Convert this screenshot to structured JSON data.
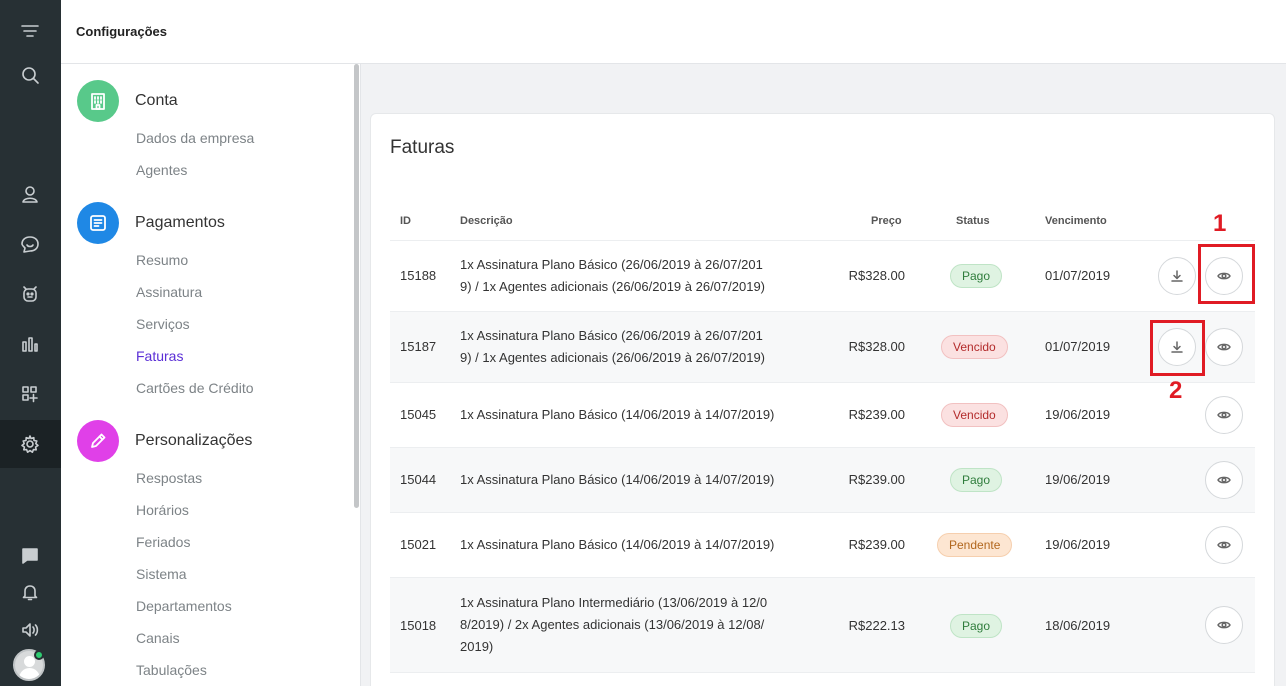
{
  "topbar": {
    "title": "Configurações"
  },
  "rail": {
    "icons": [
      "logo-icon",
      "search-icon",
      "user-icon",
      "chat-smile-icon",
      "bot-icon",
      "chart-icon",
      "apps-icon",
      "gear-icon",
      "message-icon",
      "bell-icon",
      "volume-icon"
    ]
  },
  "menu": {
    "sections": [
      {
        "title": "Conta",
        "icon": "building-icon",
        "color": "#58c98a",
        "items": [
          "Dados da empresa",
          "Agentes"
        ]
      },
      {
        "title": "Pagamentos",
        "icon": "receipt-icon",
        "color": "#1f88e5",
        "items": [
          "Resumo",
          "Assinatura",
          "Serviços",
          "Faturas",
          "Cartões de Crédito"
        ]
      },
      {
        "title": "Personalizações",
        "icon": "pencil-icon",
        "color": "#e040e8",
        "items": [
          "Respostas",
          "Horários",
          "Feriados",
          "Sistema",
          "Departamentos",
          "Canais",
          "Tabulações"
        ]
      }
    ],
    "active_item": "Faturas"
  },
  "card": {
    "title": "Faturas",
    "columns": {
      "id": "ID",
      "descricao": "Descrição",
      "preco": "Preço",
      "status": "Status",
      "vencimento": "Vencimento"
    },
    "rows": [
      {
        "id": "15188",
        "desc": [
          "1x Assinatura Plano Básico (26/06/2019 à 26/07/201",
          "9) / 1x Agentes adicionais (26/06/2019 à 26/07/2019)"
        ],
        "price": "R$328.00",
        "status": "Pago",
        "due": "01/07/2019",
        "download": true
      },
      {
        "id": "15187",
        "desc": [
          "1x Assinatura Plano Básico (26/06/2019 à 26/07/201",
          "9) / 1x Agentes adicionais (26/06/2019 à 26/07/2019)"
        ],
        "price": "R$328.00",
        "status": "Vencido",
        "due": "01/07/2019",
        "download": true
      },
      {
        "id": "15045",
        "desc": [
          "1x Assinatura Plano Básico (14/06/2019 à 14/07/2019)"
        ],
        "price": "R$239.00",
        "status": "Vencido",
        "due": "19/06/2019",
        "download": false
      },
      {
        "id": "15044",
        "desc": [
          "1x Assinatura Plano Básico (14/06/2019 à 14/07/2019)"
        ],
        "price": "R$239.00",
        "status": "Pago",
        "due": "19/06/2019",
        "download": false
      },
      {
        "id": "15021",
        "desc": [
          "1x Assinatura Plano Básico (14/06/2019 à 14/07/2019)"
        ],
        "price": "R$239.00",
        "status": "Pendente",
        "due": "19/06/2019",
        "download": false
      },
      {
        "id": "15018",
        "desc": [
          "1x Assinatura Plano Intermediário (13/06/2019 à 12/0",
          "8/2019) / 2x Agentes adicionais (13/06/2019 à 12/08/",
          "2019)"
        ],
        "price": "R$222.13",
        "status": "Pago",
        "due": "18/06/2019",
        "download": false
      }
    ]
  },
  "annotations": {
    "one": "1",
    "two": "2",
    "color": "#e01b24"
  }
}
